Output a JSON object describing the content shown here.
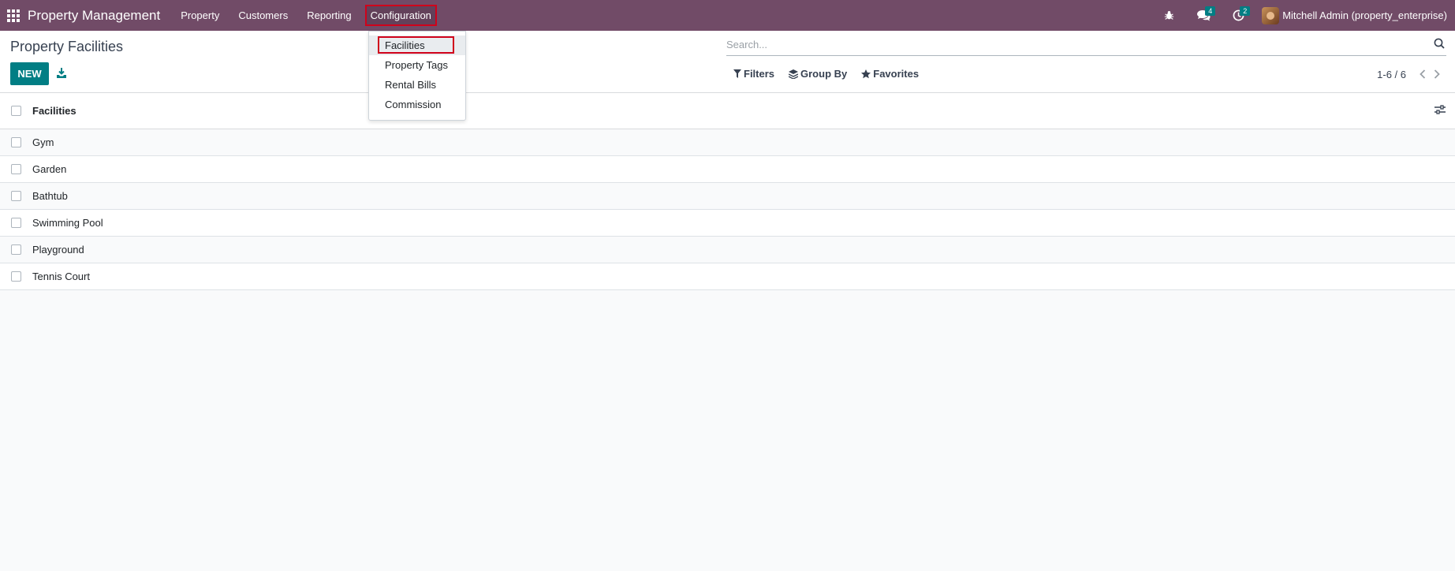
{
  "navbar": {
    "brand": "Property Management",
    "menu": [
      "Property",
      "Customers",
      "Reporting",
      "Configuration"
    ],
    "messages_badge": "4",
    "activities_badge": "2",
    "user": "Mitchell Admin (property_enterprise)",
    "color": "#714B67"
  },
  "configuration_menu": {
    "items": [
      "Facilities",
      "Property Tags",
      "Rental Bills",
      "Commission"
    ],
    "active": "Facilities"
  },
  "control": {
    "title": "Property Facilities",
    "new_label": "NEW",
    "search_placeholder": "Search...",
    "filters_label": "Filters",
    "groupby_label": "Group By",
    "favorites_label": "Favorites",
    "pager_value": "1-6 / 6"
  },
  "list": {
    "column": "Facilities",
    "rows": [
      "Gym",
      "Garden",
      "Bathtub",
      "Swimming Pool",
      "Playground",
      "Tennis Court"
    ]
  },
  "colors": {
    "primary": "#017e84",
    "highlight": "#d0021b"
  },
  "icons": [
    "apps-grid-icon",
    "bug-icon",
    "chat-icon",
    "clock-icon",
    "download-icon",
    "search-icon",
    "filter-icon",
    "layers-icon",
    "star-icon",
    "chevron-left-icon",
    "chevron-right-icon",
    "settings-sliders-icon"
  ]
}
